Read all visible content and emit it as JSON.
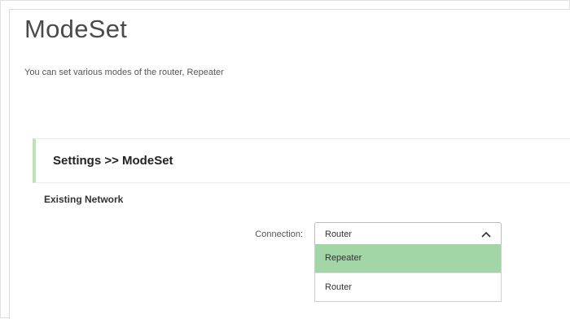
{
  "page": {
    "title": "ModeSet",
    "description": "You can set various modes of the router, Repeater"
  },
  "section": {
    "title": "Settings >> ModeSet"
  },
  "subsection": {
    "title": "Existing Network"
  },
  "connection": {
    "label": "Connection:",
    "selected": "Router",
    "expanded_icon": "chevron-up-icon",
    "options": [
      {
        "label": "Repeater",
        "highlighted": true
      },
      {
        "label": "Router",
        "highlighted": false
      }
    ]
  },
  "colors": {
    "highlight": "#a3d6a7",
    "section_accent": "#bfe3b4"
  }
}
